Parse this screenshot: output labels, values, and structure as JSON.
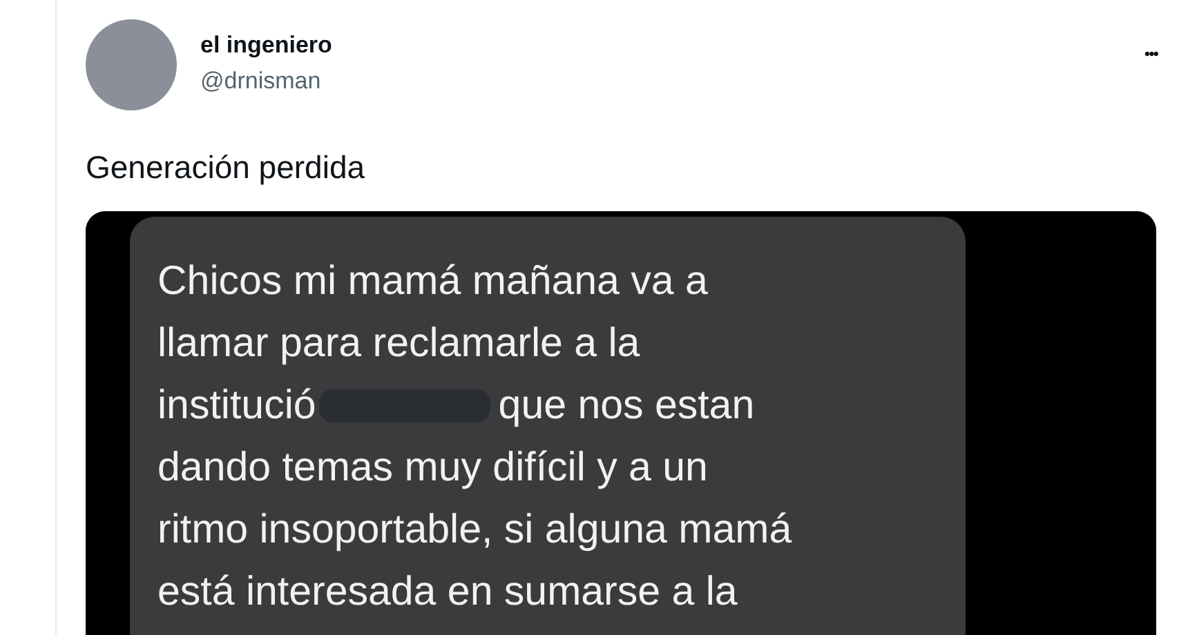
{
  "author": {
    "name": "el ingeniero",
    "handle": "@drnisman"
  },
  "more_button": "•••",
  "tweet_text": "Generación perdida",
  "message": {
    "lines": [
      [
        {
          "kind": "text",
          "text": "Chicos mi mamá mañana va a"
        }
      ],
      [
        {
          "kind": "text",
          "text": "llamar para reclamarle a la"
        }
      ],
      [
        {
          "kind": "text",
          "text": "institució"
        },
        {
          "kind": "redaction"
        },
        {
          "kind": "text",
          "text": "que nos estan"
        }
      ],
      [
        {
          "kind": "text",
          "text": "dando temas muy difícil y a un"
        }
      ],
      [
        {
          "kind": "text",
          "text": "ritmo insoportable, si alguna mamá"
        }
      ],
      [
        {
          "kind": "text",
          "text": "está interesada en sumarse a la"
        }
      ]
    ]
  }
}
